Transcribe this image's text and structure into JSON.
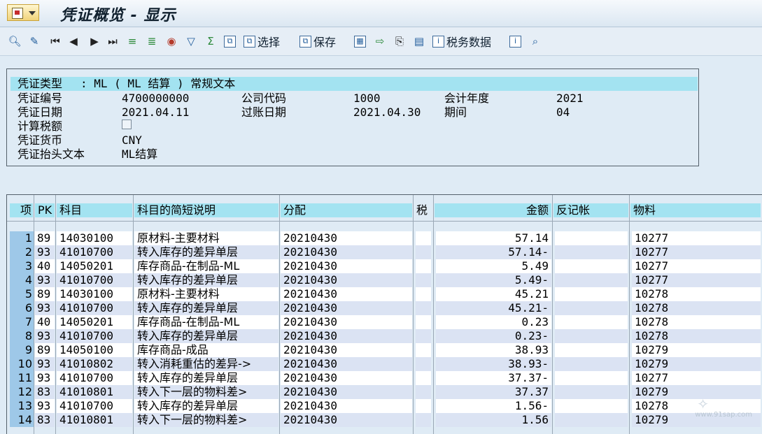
{
  "window": {
    "title": "凭证概览 - 显示"
  },
  "toolbar": {
    "select_label": "选择",
    "save_label": "保存",
    "tax_data_label": "税务数据"
  },
  "header": {
    "doc_type_label": "凭证类型",
    "doc_type_value": ": ML ( ML 结算 ) 常规文本",
    "doc_number_label": "凭证编号",
    "doc_number_value": "4700000000",
    "company_code_label": "公司代码",
    "company_code_value": "1000",
    "fiscal_year_label": "会计年度",
    "fiscal_year_value": "2021",
    "doc_date_label": "凭证日期",
    "doc_date_value": "2021.04.11",
    "posting_date_label": "过账日期",
    "posting_date_value": "2021.04.30",
    "period_label": "期间",
    "period_value": "04",
    "calc_tax_label": "计算税额",
    "calc_tax_checked": false,
    "currency_label": "凭证货币",
    "currency_value": "CNY",
    "header_text_label": "凭证抬头文本",
    "header_text_value": "ML结算"
  },
  "table": {
    "columns": {
      "item": "项",
      "pk": "PK",
      "account": "科目",
      "account_desc": "科目的简短说明",
      "assignment": "分配",
      "tax": "税",
      "amount": "金额",
      "reversal": "反记帐",
      "material": "物料"
    },
    "rows": [
      {
        "item": "1",
        "pk": "89",
        "account": "14030100",
        "desc": "原材料-主要材料",
        "assignment": "20210430",
        "amount": "57.14",
        "material": "10277"
      },
      {
        "item": "2",
        "pk": "93",
        "account": "41010700",
        "desc": "转入库存的差异单层",
        "assignment": "20210430",
        "amount": "57.14-",
        "material": "10277"
      },
      {
        "item": "3",
        "pk": "40",
        "account": "14050201",
        "desc": "库存商品-在制品-ML",
        "assignment": "20210430",
        "amount": "5.49",
        "material": "10277"
      },
      {
        "item": "4",
        "pk": "93",
        "account": "41010700",
        "desc": "转入库存的差异单层",
        "assignment": "20210430",
        "amount": "5.49-",
        "material": "10277"
      },
      {
        "item": "5",
        "pk": "89",
        "account": "14030100",
        "desc": "原材料-主要材料",
        "assignment": "20210430",
        "amount": "45.21",
        "material": "10278"
      },
      {
        "item": "6",
        "pk": "93",
        "account": "41010700",
        "desc": "转入库存的差异单层",
        "assignment": "20210430",
        "amount": "45.21-",
        "material": "10278"
      },
      {
        "item": "7",
        "pk": "40",
        "account": "14050201",
        "desc": "库存商品-在制品-ML",
        "assignment": "20210430",
        "amount": "0.23",
        "material": "10278"
      },
      {
        "item": "8",
        "pk": "93",
        "account": "41010700",
        "desc": "转入库存的差异单层",
        "assignment": "20210430",
        "amount": "0.23-",
        "material": "10278"
      },
      {
        "item": "9",
        "pk": "89",
        "account": "14050100",
        "desc": "库存商品-成品",
        "assignment": "20210430",
        "amount": "38.93",
        "material": "10279"
      },
      {
        "item": "10",
        "pk": "93",
        "account": "41010802",
        "desc": "转入消耗重估的差异->",
        "assignment": "20210430",
        "amount": "38.93-",
        "material": "10279"
      },
      {
        "item": "11",
        "pk": "93",
        "account": "41010700",
        "desc": "转入库存的差异单层",
        "assignment": "20210430",
        "amount": "37.37-",
        "material": "10277"
      },
      {
        "item": "12",
        "pk": "83",
        "account": "41010801",
        "desc": "转入下一层的物料差>",
        "assignment": "20210430",
        "amount": "37.37",
        "material": "10279"
      },
      {
        "item": "13",
        "pk": "93",
        "account": "41010700",
        "desc": "转入库存的差异单层",
        "assignment": "20210430",
        "amount": "1.56-",
        "material": "10278"
      },
      {
        "item": "14",
        "pk": "83",
        "account": "41010801",
        "desc": "转入下一层的物料差>",
        "assignment": "20210430",
        "amount": "1.56",
        "material": "10279"
      }
    ]
  },
  "watermark": {
    "text": "www.91sap.com"
  }
}
